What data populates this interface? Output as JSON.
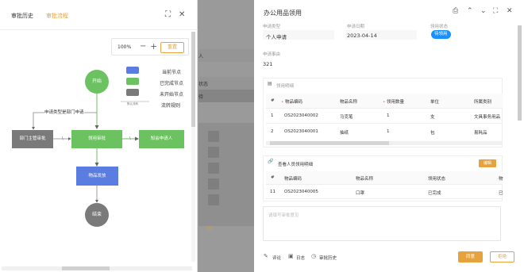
{
  "left_panel": {
    "tabs": [
      {
        "label": "审批历史",
        "active": false
      },
      {
        "label": "审批流程",
        "active": true
      }
    ],
    "zoom": {
      "percent": "100%",
      "minus": "−",
      "plus": "+",
      "reset_label": "重置"
    },
    "legend": [
      {
        "label": "当前节点",
        "color": "#5b7ce0"
      },
      {
        "label": "已完成节点",
        "color": "#6cc160"
      },
      {
        "label": "未开始节点",
        "color": "#7a7a7a"
      },
      {
        "label": "流转规则",
        "color": "#999999",
        "line_caption": "默认流转"
      }
    ],
    "flow": {
      "start": "开始",
      "condition_label": "申请类型是部门申请",
      "dept_approval": "部门主管审批",
      "collect_approval": "领用审批",
      "notify": "知会申请人",
      "distribute": "物品发放",
      "end": "结束",
      "slash_marks": [
        "\\",
        "\\"
      ]
    }
  },
  "background": {
    "fragments": [
      "人",
      "状态",
      "待",
      "20"
    ]
  },
  "drawer": {
    "title": "办公用品领用",
    "icons": [
      "print-icon",
      "chevron-up-icon",
      "chevron-down-icon",
      "fullscreen-icon",
      "close-icon"
    ],
    "fields": {
      "apply_type_label": "申请类型",
      "apply_type_value": "个人申请",
      "apply_date_label": "申请日期",
      "apply_date_value": "2023-04-14",
      "status_label": "领用状态",
      "status_value": "待领用",
      "reason_label": "申请事由",
      "reason_value": "321"
    },
    "detail_table": {
      "section_title": "领用明细",
      "headers": [
        "#",
        "物品编码",
        "物品名称",
        "领用数量",
        "单位",
        "所属类别"
      ],
      "required": [
        false,
        true,
        false,
        true,
        false,
        false
      ],
      "rows": [
        [
          "1",
          "OS2023040002",
          "马克笔",
          "1",
          "支",
          "文具事务用品"
        ],
        [
          "2",
          "OS2023040001",
          "抽纸",
          "1",
          "包",
          "易耗品"
        ]
      ]
    },
    "people_table": {
      "section_title": "查看人员领用明细",
      "edit_label": "编辑",
      "headers": [
        "#",
        "物品编码",
        "物品名称",
        "领用状态",
        "物"
      ],
      "rows": [
        [
          "11",
          "OS2023040005",
          "口罩",
          "已完成",
          "已"
        ]
      ]
    },
    "comment_placeholder": "请填写审批意见",
    "footer_links": [
      {
        "icon": "comment-icon",
        "label": "评论"
      },
      {
        "icon": "log-icon",
        "label": "日志"
      },
      {
        "icon": "history-icon",
        "label": "审批历史"
      }
    ],
    "approve_label": "同意",
    "reject_label": "拒绝"
  }
}
